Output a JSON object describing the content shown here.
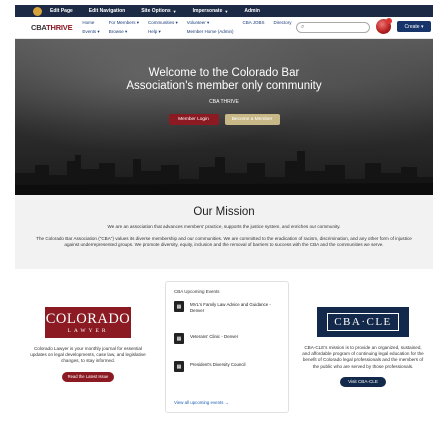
{
  "admin_bar": {
    "items": [
      {
        "label": "Edit Page",
        "caret": false
      },
      {
        "label": "Edit Navigation",
        "caret": false
      },
      {
        "label": "Site Options",
        "caret": true
      },
      {
        "label": "Impersonate",
        "caret": true
      },
      {
        "label": "Admin",
        "caret": false
      }
    ]
  },
  "header": {
    "logo_cba": "CBA",
    "logo_thrive": "THRIVE",
    "nav_row1": [
      "Home",
      "For Members ▾",
      "Communities ▾",
      "Volunteer ▾",
      "CBA JOBS",
      "Directory"
    ],
    "nav_row2": [
      "Events ▾",
      "Browse ▾",
      "Help ▾",
      "Member Home (Admin)"
    ],
    "create_label": "Create ▾"
  },
  "hero": {
    "title_line1": "Welcome to the Colorado Bar",
    "title_line2": "Association's member only community",
    "subtitle": "CBA THRIVE",
    "login_label": "Member Login",
    "become_label": "Become a Member"
  },
  "mission": {
    "title": "Our Mission",
    "lead": "We are an association that advances members' practice, supports the justice system, and enriches our community.",
    "body": "The Colorado Bar Association (\"CBA\") values its diverse membership and our communities. We are committed to the eradication of racism, discrimination, and any other form of injustice against underrepresented groups. We promote diversity, equity, inclusion and the removal of barriers to success with the CBA and the communities we serve."
  },
  "colorado_lawyer": {
    "logo_big": "COLORADO",
    "logo_small": "LAWYER",
    "description": "Colorado Lawyer is your monthly journal for essential updates on legal developments, case law, and legislative changes, to stay informed.",
    "button_label": "Read the Latest Issue"
  },
  "events": {
    "heading": "CBA Upcoming Events",
    "items": [
      {
        "title": "MVL's Family Law Advice and Guidance - Denver"
      },
      {
        "title": "Veterans' Clinic - Denver"
      },
      {
        "title": "President's Diversity Council"
      }
    ],
    "view_all": "View all upcoming events →"
  },
  "cba_cle": {
    "logo_text": "CBA·CLE",
    "description": "CBA-CLE's mission is to provide an organized, sustained, and affordable program of continuing legal education for the benefit of Colorado legal professionals and the members of the public who are served by those professionals.",
    "button_label": "Visit CBA-CLE"
  },
  "colors": {
    "brand_red": "#8b1a23",
    "navy": "#13294b",
    "tan": "#c9b887",
    "admin_bar": "#1c2a45"
  }
}
